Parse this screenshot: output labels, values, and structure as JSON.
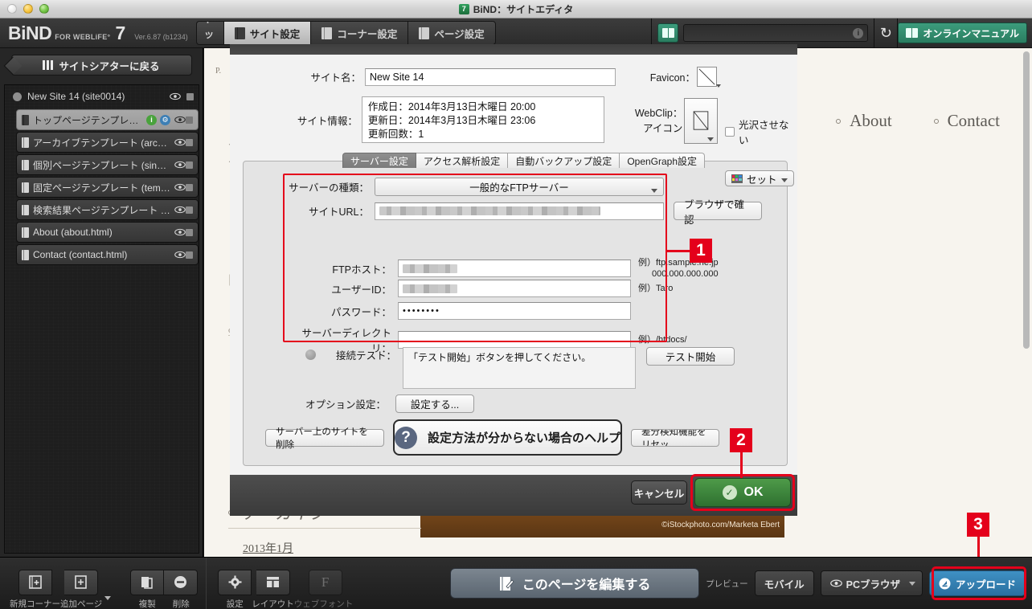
{
  "window": {
    "title": "BiND：サイトエディタ",
    "app_badge": "7"
  },
  "toolbar": {
    "brand_1": "BiND",
    "brand_2": "FOR WEBLiFE°",
    "brand_3": "7",
    "version": "Ver.6.87 (b1234)",
    "tabs": [
      {
        "label": "トップ",
        "active": false
      },
      {
        "label": "サイト設定",
        "active": true
      },
      {
        "label": "コーナー設定",
        "active": false
      },
      {
        "label": "ページ設定",
        "active": false
      }
    ],
    "manual_label": "オンラインマニュアル",
    "refresh_glyph": "↻",
    "info_glyph": "i"
  },
  "sidebar": {
    "back_label": "サイトシアターに戻る",
    "root_label": "New Site 14 (site0014)",
    "items": [
      {
        "label": "トップページテンプレー...",
        "selected": true,
        "badges": [
          "info",
          "gear"
        ]
      },
      {
        "label": "アーカイブテンプレート (archiv...",
        "selected": false,
        "badges": []
      },
      {
        "label": "個別ページテンプレート (single...",
        "selected": false,
        "badges": []
      },
      {
        "label": "固定ページテンプレート (templ...",
        "selected": false,
        "badges": []
      },
      {
        "label": "検索結果ページテンプレート (s...",
        "selected": false,
        "badges": []
      },
      {
        "label": "About (about.html)",
        "selected": false,
        "badges": []
      },
      {
        "label": "Contact (contact.html)",
        "selected": false,
        "badges": []
      }
    ]
  },
  "page_preview": {
    "ghost_p": "P.",
    "ghost_bracket": "]",
    "ghost_square": "[",
    "ghost_o": "o",
    "nav": [
      "About",
      "Contact"
    ],
    "archive_heading": "アーカイブ",
    "archive_link": "2013年1月",
    "photo_credit": "©iStockphoto.com/Marketa Ebert"
  },
  "dialog": {
    "site_name_label": "サイト名：",
    "site_name_value": "New Site 14",
    "favicon_label": "Favicon：",
    "site_info_label": "サイト情報：",
    "site_info_lines": [
      "作成日：2014年3月13日木曜日 20:00",
      "更新日：2014年3月13日木曜日 23:06",
      "更新回数：1"
    ],
    "webclip_label_1": "WebClip：",
    "webclip_label_2": "アイコン",
    "gloss_checkbox_label": "光沢させない",
    "tabs": [
      {
        "label": "サーバー設定",
        "active": true
      },
      {
        "label": "アクセス解析設定",
        "active": false
      },
      {
        "label": "自動バックアップ設定",
        "active": false
      },
      {
        "label": "OpenGraph設定",
        "active": false
      }
    ],
    "set_button_label": "セット",
    "server_type_label": "サーバーの種類：",
    "server_type_value": "一般的なFTPサーバー",
    "site_url_label": "サイトURL：",
    "site_url_value": "",
    "browse_check_label": "ブラウザで確認",
    "ftp_host_label": "FTPホスト：",
    "ftp_host_value": "",
    "ftp_host_example_1": "例）ftp.sample.ne.jp",
    "ftp_host_example_2": "000.000.000.000",
    "user_id_label": "ユーザーID：",
    "user_id_value": "",
    "user_id_example": "例）Taro",
    "password_label": "パスワード：",
    "password_value": "••••••••",
    "server_dir_label": "サーバーディレクトリ：",
    "server_dir_value": "",
    "server_dir_example": "例）/htdocs/",
    "conn_test_label": "接続テスト：",
    "conn_test_message": "「テスト開始」ボタンを押してください。",
    "test_start_label": "テスト開始",
    "option_label": "オプション設定：",
    "option_button_label": "設定する...",
    "delete_site_label": "サーバー上のサイトを削除",
    "help_button_label": "設定方法が分からない場合のヘルプ",
    "help_icon_glyph": "?",
    "reset_diff_label": "差分検知機能をリセッ",
    "cancel_label": "キャンセル",
    "ok_label": "OK",
    "ok_check_glyph": "✓"
  },
  "bottombar": {
    "new_corner_label": "新規コーナー",
    "add_page_label": "追加ページ",
    "duplicate_label": "複製",
    "delete_label": "削除",
    "settings_label": "設定",
    "layout_label": "レイアウト",
    "webfont_label": "ウェブフォント",
    "edit_page_label": "このページを編集する",
    "preview_label": "プレビュー",
    "mobile_label": "モバイル",
    "pc_browser_label": "PCブラウザ",
    "upload_label": "アップロード"
  },
  "callouts": [
    {
      "number": "1"
    },
    {
      "number": "2"
    },
    {
      "number": "3"
    }
  ],
  "colors": {
    "accent_red": "#e4001b",
    "ok_green": "#3e8a3c",
    "upload_blue": "#3484b9",
    "teal": "#2e8468"
  }
}
